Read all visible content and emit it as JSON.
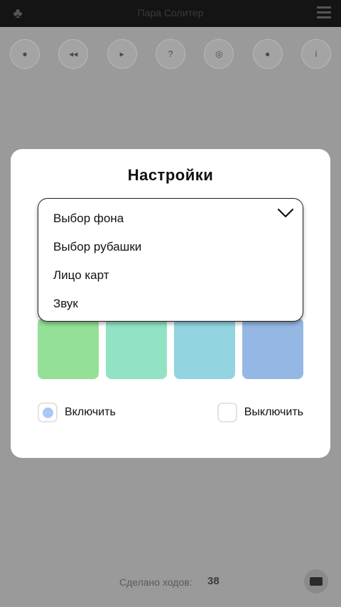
{
  "app": {
    "title": "Пара Солитер",
    "toolbar": [
      {
        "name": "tool-button-undo",
        "glyph": "●"
      },
      {
        "name": "tool-button-replay",
        "glyph": "◂◂"
      },
      {
        "name": "tool-button-redo",
        "glyph": "▸"
      },
      {
        "name": "tool-button-hint",
        "glyph": "?"
      },
      {
        "name": "tool-button-settings",
        "glyph": "◎"
      },
      {
        "name": "tool-button-stats",
        "glyph": "●"
      },
      {
        "name": "tool-button-info",
        "glyph": "i"
      }
    ],
    "footer": {
      "moves_label": "Сделано ходов:",
      "moves_count": "38"
    }
  },
  "modal": {
    "title": "Настройки",
    "dropdown": {
      "items": [
        "Выбор фона",
        "Выбор рубашки",
        "Лицо карт",
        "Звук"
      ]
    },
    "swatches": [
      "#94e096",
      "#92e3c3",
      "#92d4e0",
      "#94b8e3"
    ],
    "sound": {
      "on_label": "Включить",
      "off_label": "Выключить",
      "selected": "on"
    }
  },
  "colors": {
    "radio_dot": "#a9c8f5",
    "topbar": "#141414",
    "overlay": "#9a9a9a"
  }
}
